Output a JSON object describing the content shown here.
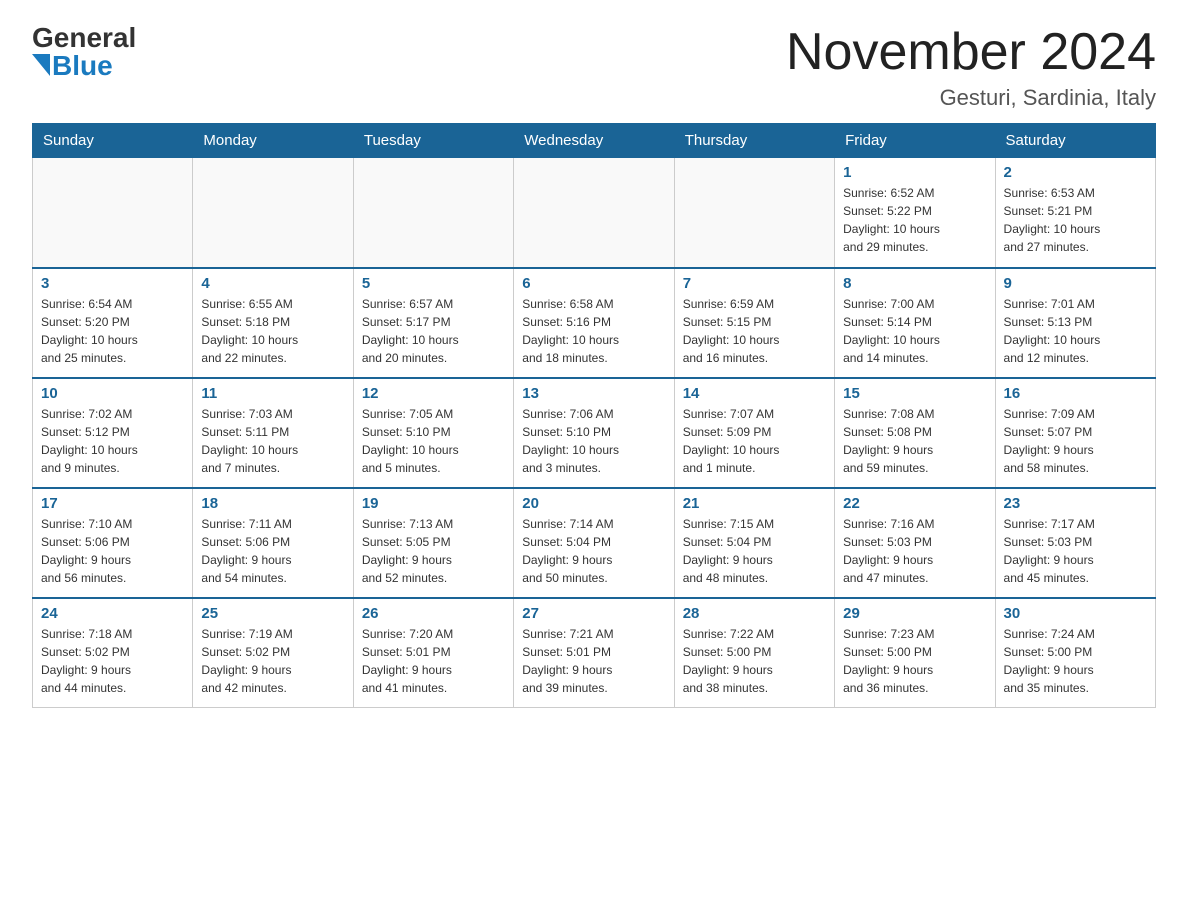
{
  "logo": {
    "general": "General",
    "blue": "Blue"
  },
  "title": {
    "month": "November 2024",
    "location": "Gesturi, Sardinia, Italy"
  },
  "weekdays": [
    "Sunday",
    "Monday",
    "Tuesday",
    "Wednesday",
    "Thursday",
    "Friday",
    "Saturday"
  ],
  "weeks": [
    [
      {
        "day": "",
        "info": ""
      },
      {
        "day": "",
        "info": ""
      },
      {
        "day": "",
        "info": ""
      },
      {
        "day": "",
        "info": ""
      },
      {
        "day": "",
        "info": ""
      },
      {
        "day": "1",
        "info": "Sunrise: 6:52 AM\nSunset: 5:22 PM\nDaylight: 10 hours\nand 29 minutes."
      },
      {
        "day": "2",
        "info": "Sunrise: 6:53 AM\nSunset: 5:21 PM\nDaylight: 10 hours\nand 27 minutes."
      }
    ],
    [
      {
        "day": "3",
        "info": "Sunrise: 6:54 AM\nSunset: 5:20 PM\nDaylight: 10 hours\nand 25 minutes."
      },
      {
        "day": "4",
        "info": "Sunrise: 6:55 AM\nSunset: 5:18 PM\nDaylight: 10 hours\nand 22 minutes."
      },
      {
        "day": "5",
        "info": "Sunrise: 6:57 AM\nSunset: 5:17 PM\nDaylight: 10 hours\nand 20 minutes."
      },
      {
        "day": "6",
        "info": "Sunrise: 6:58 AM\nSunset: 5:16 PM\nDaylight: 10 hours\nand 18 minutes."
      },
      {
        "day": "7",
        "info": "Sunrise: 6:59 AM\nSunset: 5:15 PM\nDaylight: 10 hours\nand 16 minutes."
      },
      {
        "day": "8",
        "info": "Sunrise: 7:00 AM\nSunset: 5:14 PM\nDaylight: 10 hours\nand 14 minutes."
      },
      {
        "day": "9",
        "info": "Sunrise: 7:01 AM\nSunset: 5:13 PM\nDaylight: 10 hours\nand 12 minutes."
      }
    ],
    [
      {
        "day": "10",
        "info": "Sunrise: 7:02 AM\nSunset: 5:12 PM\nDaylight: 10 hours\nand 9 minutes."
      },
      {
        "day": "11",
        "info": "Sunrise: 7:03 AM\nSunset: 5:11 PM\nDaylight: 10 hours\nand 7 minutes."
      },
      {
        "day": "12",
        "info": "Sunrise: 7:05 AM\nSunset: 5:10 PM\nDaylight: 10 hours\nand 5 minutes."
      },
      {
        "day": "13",
        "info": "Sunrise: 7:06 AM\nSunset: 5:10 PM\nDaylight: 10 hours\nand 3 minutes."
      },
      {
        "day": "14",
        "info": "Sunrise: 7:07 AM\nSunset: 5:09 PM\nDaylight: 10 hours\nand 1 minute."
      },
      {
        "day": "15",
        "info": "Sunrise: 7:08 AM\nSunset: 5:08 PM\nDaylight: 9 hours\nand 59 minutes."
      },
      {
        "day": "16",
        "info": "Sunrise: 7:09 AM\nSunset: 5:07 PM\nDaylight: 9 hours\nand 58 minutes."
      }
    ],
    [
      {
        "day": "17",
        "info": "Sunrise: 7:10 AM\nSunset: 5:06 PM\nDaylight: 9 hours\nand 56 minutes."
      },
      {
        "day": "18",
        "info": "Sunrise: 7:11 AM\nSunset: 5:06 PM\nDaylight: 9 hours\nand 54 minutes."
      },
      {
        "day": "19",
        "info": "Sunrise: 7:13 AM\nSunset: 5:05 PM\nDaylight: 9 hours\nand 52 minutes."
      },
      {
        "day": "20",
        "info": "Sunrise: 7:14 AM\nSunset: 5:04 PM\nDaylight: 9 hours\nand 50 minutes."
      },
      {
        "day": "21",
        "info": "Sunrise: 7:15 AM\nSunset: 5:04 PM\nDaylight: 9 hours\nand 48 minutes."
      },
      {
        "day": "22",
        "info": "Sunrise: 7:16 AM\nSunset: 5:03 PM\nDaylight: 9 hours\nand 47 minutes."
      },
      {
        "day": "23",
        "info": "Sunrise: 7:17 AM\nSunset: 5:03 PM\nDaylight: 9 hours\nand 45 minutes."
      }
    ],
    [
      {
        "day": "24",
        "info": "Sunrise: 7:18 AM\nSunset: 5:02 PM\nDaylight: 9 hours\nand 44 minutes."
      },
      {
        "day": "25",
        "info": "Sunrise: 7:19 AM\nSunset: 5:02 PM\nDaylight: 9 hours\nand 42 minutes."
      },
      {
        "day": "26",
        "info": "Sunrise: 7:20 AM\nSunset: 5:01 PM\nDaylight: 9 hours\nand 41 minutes."
      },
      {
        "day": "27",
        "info": "Sunrise: 7:21 AM\nSunset: 5:01 PM\nDaylight: 9 hours\nand 39 minutes."
      },
      {
        "day": "28",
        "info": "Sunrise: 7:22 AM\nSunset: 5:00 PM\nDaylight: 9 hours\nand 38 minutes."
      },
      {
        "day": "29",
        "info": "Sunrise: 7:23 AM\nSunset: 5:00 PM\nDaylight: 9 hours\nand 36 minutes."
      },
      {
        "day": "30",
        "info": "Sunrise: 7:24 AM\nSunset: 5:00 PM\nDaylight: 9 hours\nand 35 minutes."
      }
    ]
  ]
}
